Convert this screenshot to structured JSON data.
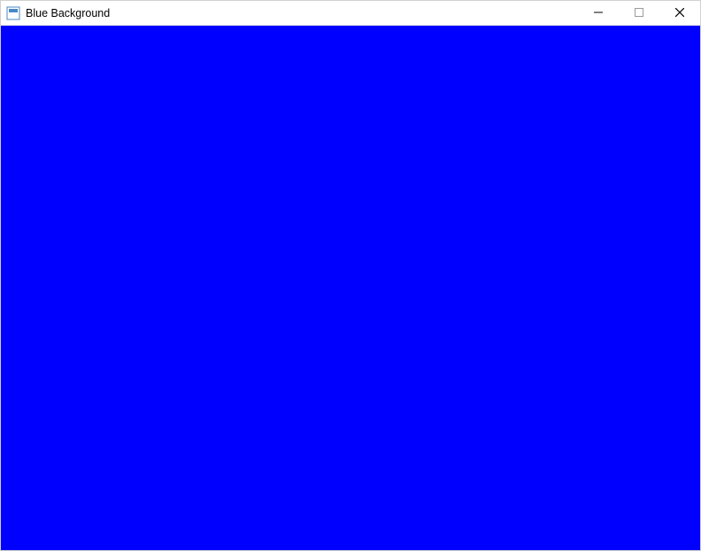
{
  "window": {
    "title": "Blue Background",
    "content_color": "#0000ff"
  }
}
